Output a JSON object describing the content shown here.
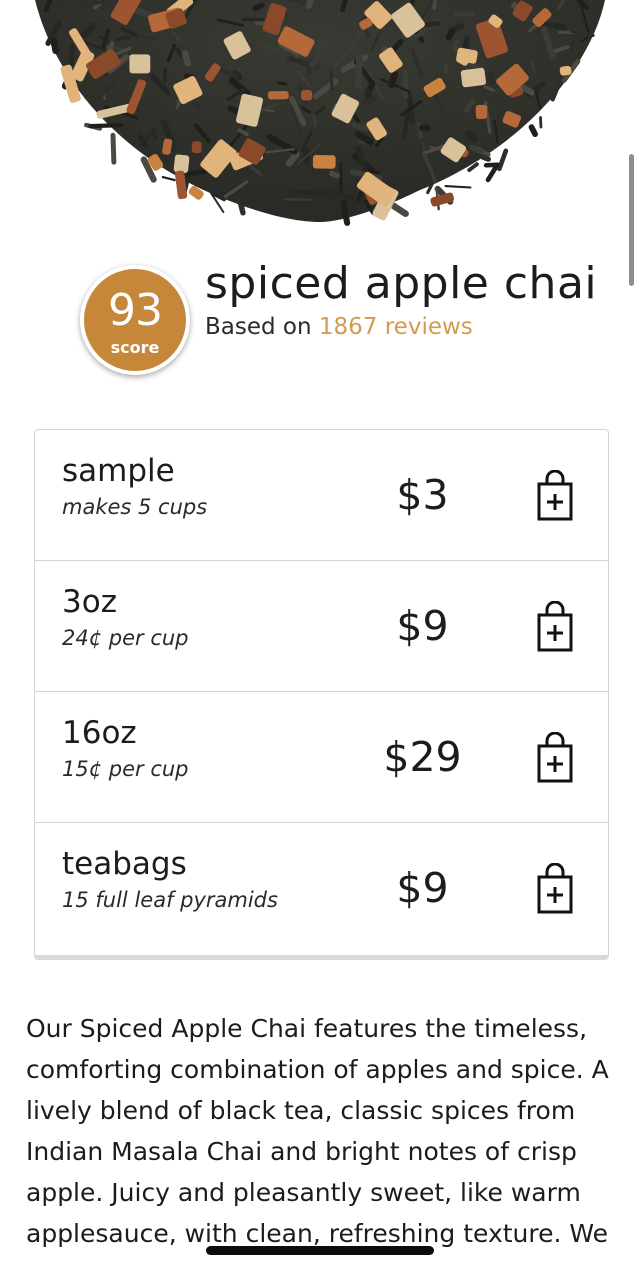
{
  "product": {
    "score": "93",
    "score_label": "score",
    "title": "spiced apple chai",
    "reviews_prefix": "Based on ",
    "reviews_link": "1867 reviews"
  },
  "options": [
    {
      "name": "sample",
      "detail": "makes 5 cups",
      "price": "$3",
      "icon": "shopping-bag-plus-icon"
    },
    {
      "name": "3oz",
      "detail": "24¢ per cup",
      "price": "$9",
      "icon": "shopping-bag-plus-icon"
    },
    {
      "name": "16oz",
      "detail": "15¢ per cup",
      "price": "$29",
      "icon": "shopping-bag-plus-icon"
    },
    {
      "name": "teabags",
      "detail": "15 full leaf pyramids",
      "price": "$9",
      "icon": "shopping-bag-plus-icon"
    }
  ],
  "description": "Our Spiced Apple Chai features the timeless, comforting combination of apples and spice. A lively blend of black tea, classic spices from Indian Masala Chai and bright notes of crisp apple. Juicy and pleasantly sweet, like warm applesauce, with clean, refreshing texture. We",
  "colors": {
    "accent": "#c7873a",
    "link": "#d39a52",
    "text": "#1c1c1c",
    "border": "#d4d4d4"
  }
}
